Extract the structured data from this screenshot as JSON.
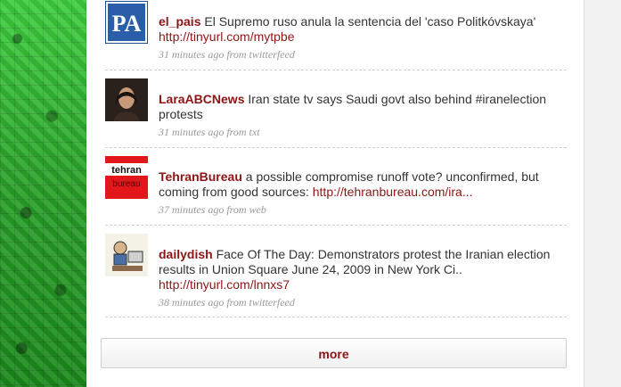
{
  "tweets": [
    {
      "user": "el_pais",
      "text": "El Supremo ruso anula la sentencia del 'caso Politkóvskaya'",
      "link": "http://tinyurl.com/mytpbe",
      "meta": "31 minutes ago from twitterfeed",
      "avatar_text": "PA"
    },
    {
      "user": "LaraABCNews",
      "text": "Iran state tv says Saudi govt also behind #iranelection protests",
      "link": "",
      "meta": "31 minutes ago from txt"
    },
    {
      "user": "TehranBureau",
      "text": "a possible compromise runoff vote? unconfirmed, but coming from good sources:",
      "link": "http://tehranbureau.com/ira...",
      "meta": "37 minutes ago from web",
      "avatar_text_1": "tehran",
      "avatar_text_2": "bureau"
    },
    {
      "user": "dailydish",
      "text": "Face Of The Day: Demonstrators protest the Iranian election results in Union Square June 24, 2009 in New York Ci..",
      "link": "http://tinyurl.com/lnnxs7",
      "meta": "38 minutes ago from twitterfeed"
    }
  ],
  "more_label": "more",
  "colors": {
    "accent": "#8c1515",
    "bg_green": "#2fae2f"
  }
}
